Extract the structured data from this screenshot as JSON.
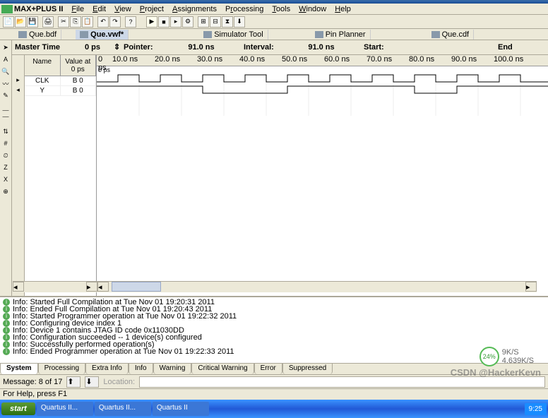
{
  "app": {
    "name": "MAX+PLUS II"
  },
  "menu": [
    "File",
    "Edit",
    "View",
    "Project",
    "Assignments",
    "Processing",
    "Tools",
    "Window",
    "Help"
  ],
  "doc_tabs": [
    {
      "label": "Que.bdf",
      "active": false
    },
    {
      "label": "Que.vwf*",
      "active": true
    },
    {
      "label": "Simulator Tool",
      "active": false
    },
    {
      "label": "Pin Planner",
      "active": false
    },
    {
      "label": "Que.cdf",
      "active": false
    }
  ],
  "time_header": {
    "master_label": "Master Time",
    "master_val": "0 ps",
    "pointer_label": "Pointer:",
    "pointer_val": "91.0 ns",
    "interval_label": "Interval:",
    "interval_val": "91.0 ns",
    "start_label": "Start:",
    "end_label": "End"
  },
  "sig_header": {
    "name": "Name",
    "value": "Value at\n0 ps"
  },
  "signals": [
    {
      "name": "CLK",
      "value": "B 0"
    },
    {
      "name": "Y",
      "value": "B 0"
    }
  ],
  "time_ticks": [
    "0 ps",
    "10.0 ns",
    "20.0 ns",
    "30.0 ns",
    "40.0 ns",
    "50.0 ns",
    "60.0 ns",
    "70.0 ns",
    "80.0 ns",
    "90.0 ns",
    "100.0 ns"
  ],
  "time_cursor": "0 ps",
  "log": [
    "Info: Started Full Compilation at Tue Nov 01 19:20:31 2011",
    "Info: Ended Full Compilation at Tue Nov 01 19:20:43 2011",
    "Info: Started Programmer operation at Tue Nov 01 19:22:32 2011",
    "Info: Configuring device index 1",
    "Info: Device 1 contains JTAG ID code 0x11030DD",
    "Info: Configuration succeeded -- 1 device(s) configured",
    "Info: Successfully performed operation(s)",
    "Info: Ended Programmer operation at Tue Nov 01 19:22:33 2011"
  ],
  "log_tabs": [
    "System",
    "Processing",
    "Extra Info",
    "Info",
    "Warning",
    "Critical Warning",
    "Error",
    "Suppressed"
  ],
  "msg_bar": {
    "label": "Message: 8 of 17",
    "loc": "Location:"
  },
  "status": "For Help, press F1",
  "taskbar": {
    "start": "start",
    "tasks": [
      "Quartus II...",
      "Quartus II...",
      "Quartus II"
    ],
    "tray": "9:25"
  },
  "badge": {
    "pct": "24%",
    "rate": "9K/S",
    "total": "4.639K/S"
  },
  "watermark": "CSDN @HackerKevn"
}
